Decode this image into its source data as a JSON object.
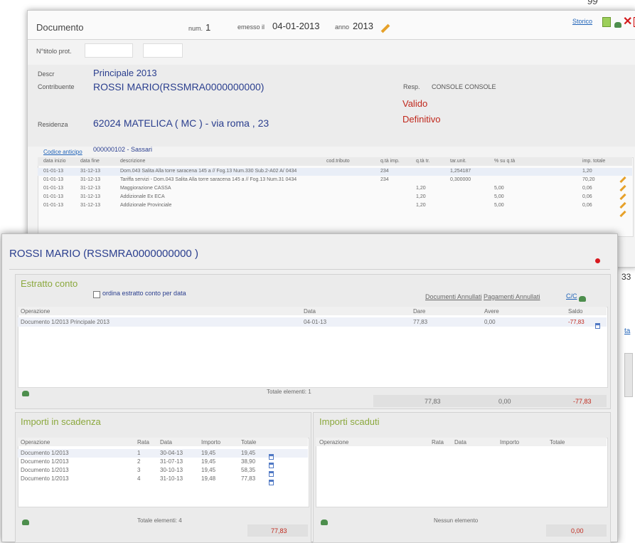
{
  "page_number": "99",
  "doc": {
    "title": "Documento",
    "num_label": "num.",
    "num_value": "1",
    "emesso_label": "emesso il",
    "emesso_value": "04-01-2013",
    "anno_label": "anno",
    "anno_value": "2013",
    "storico": "Storico",
    "nprot_label": "N°titolo prot.",
    "descr_label": "Descr",
    "descr_value": "Principale 2013",
    "contrib_label": "Contribuente",
    "contrib_value": "ROSSI MARIO(RSSMRA0000000000)",
    "resp_label": "Resp.",
    "resp_value": "CONSOLE CONSOLE",
    "valido": "Valido",
    "definitivo": "Definitivo",
    "resid_label": "Residenza",
    "resid_value": "62024 MATELICA ( MC )  - via roma ,   23",
    "codice_label": "Codice anticipo",
    "codice_value": "000000102  - Sassari",
    "grid_headers": [
      "data inizio",
      "data fine",
      "descrizione",
      "cod.tributo",
      "q.tà imp.",
      "q.tà tr.",
      "tar.unit.",
      "% su q.tà",
      "imp. totale"
    ],
    "grid_rows": [
      {
        "start": "01-01-13",
        "end": "31-12-13",
        "descr": "Dom.043 Salita Alla torre saracena 145 a // Fog.13 Num.330 Sub.2-A02 A/ 0434",
        "imp": "234",
        "tr": "",
        "unit": "1,254187",
        "pct": "",
        "tot": "1,20"
      },
      {
        "start": "01-01-13",
        "end": "31-12-13",
        "descr": "Tariffa servizi - Dom.043 Salita Alla torre saracena 145 a // Fog.13 Num.31 0434",
        "imp": "234",
        "tr": "",
        "unit": "0,300000",
        "pct": "",
        "tot": "70,20"
      },
      {
        "start": "01-01-13",
        "end": "31-12-13",
        "descr": "Maggiorazione CASSA",
        "imp": "",
        "tr": "1,20",
        "unit": "",
        "pct": "5,00",
        "tot": "0,06"
      },
      {
        "start": "01-01-13",
        "end": "31-12-13",
        "descr": "Addizionale Ex ECA",
        "imp": "",
        "tr": "1,20",
        "unit": "",
        "pct": "5,00",
        "tot": "0,06"
      },
      {
        "start": "01-01-13",
        "end": "31-12-13",
        "descr": "Addizionale Provinciale",
        "imp": "",
        "tr": "1,20",
        "unit": "",
        "pct": "5,00",
        "tot": "0,06"
      }
    ],
    "edge_value": "33",
    "edge_link": "ta"
  },
  "popup": {
    "title": "ROSSI MARIO (RSSMRA0000000000 )",
    "estratto": {
      "title": "Estratto conto",
      "checkbox_label": "ordina estratto conto per data",
      "link_docs": "Documenti Annullati",
      "link_pay": "Pagamenti Annullati",
      "link_cc": "C/C",
      "headers": [
        "Operazione",
        "Data",
        "Dare",
        "Avere",
        "Saldo"
      ],
      "rows": [
        {
          "op": "Documento 1/2013 Principale 2013",
          "data": "04-01-13",
          "dare": "77,83",
          "avere": "0,00",
          "saldo": "-77,83"
        }
      ],
      "footer": "Totale elementi: 1",
      "tot_dare": "77,83",
      "tot_avere": "0,00",
      "tot_saldo": "-77,83"
    },
    "scadenza": {
      "title": "Importi in scadenza",
      "headers": [
        "Operazione",
        "Rata",
        "Data",
        "Importo",
        "Totale"
      ],
      "rows": [
        {
          "op": "Documento 1/2013",
          "rata": "1",
          "data": "30-04-13",
          "imp": "19,45",
          "tot": "19,45"
        },
        {
          "op": "Documento 1/2013",
          "rata": "2",
          "data": "31-07-13",
          "imp": "19,45",
          "tot": "38,90"
        },
        {
          "op": "Documento 1/2013",
          "rata": "3",
          "data": "30-10-13",
          "imp": "19,45",
          "tot": "58,35"
        },
        {
          "op": "Documento 1/2013",
          "rata": "4",
          "data": "31-10-13",
          "imp": "19,48",
          "tot": "77,83"
        }
      ],
      "footer": "Totale elementi: 4",
      "total": "77,83"
    },
    "scaduti": {
      "title": "Importi scaduti",
      "headers": [
        "Operazione",
        "Rata",
        "Data",
        "Importo",
        "Totale"
      ],
      "footer": "Nessun elemento",
      "total": "0,00"
    }
  }
}
